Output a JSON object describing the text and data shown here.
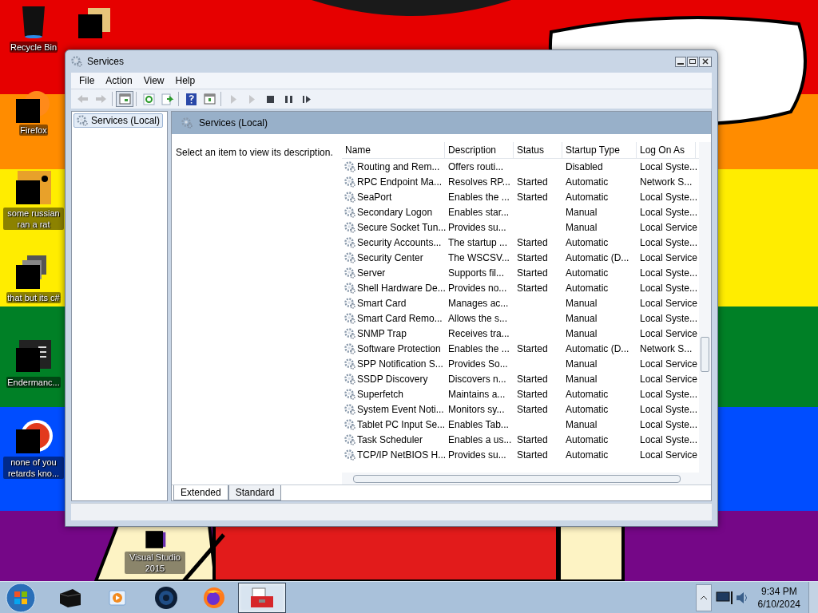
{
  "desktop_icons": [
    {
      "label": "Recycle Bin",
      "kind": "bin"
    },
    {
      "kind": "folder"
    },
    {
      "label": "Firefox",
      "kind": "browser"
    },
    {
      "label": "some russian ran a rat",
      "kind": "editor"
    },
    {
      "label": "that but its c#",
      "kind": "windows"
    },
    {
      "label": "Endermanc...",
      "kind": "console"
    },
    {
      "label": "none of you retards kno...",
      "kind": "bird"
    },
    {
      "label": "Visual Studio 2015",
      "kind": "studio"
    }
  ],
  "window": {
    "title": "Services",
    "menu": [
      "File",
      "Action",
      "View",
      "Help"
    ],
    "toolbar": [
      {
        "kind": "back",
        "disabled": true
      },
      {
        "kind": "forward",
        "disabled": true
      },
      {
        "kind": "pane",
        "disabled": false
      },
      {
        "kind": "refresh",
        "disabled": false
      },
      {
        "kind": "export",
        "disabled": false
      },
      {
        "kind": "help",
        "disabled": false
      },
      {
        "kind": "properties",
        "disabled": false
      },
      {
        "kind": "play",
        "disabled": true
      },
      {
        "kind": "play",
        "disabled": true
      },
      {
        "kind": "stop",
        "disabled": false
      },
      {
        "kind": "pause",
        "disabled": false
      },
      {
        "kind": "resume",
        "disabled": false
      }
    ],
    "tree": [
      {
        "label": "Services (Local)",
        "selected": true
      }
    ],
    "pane_title": "Services (Local)",
    "description_hint": "Select an item to view its description.",
    "table": {
      "columns": [
        "Name",
        "Description",
        "Status",
        "Startup Type",
        "Log On As"
      ],
      "rows": [
        {
          "name": "Routing and Rem...",
          "description": "Offers routi...",
          "startup_type": "Disabled",
          "log_on_as": "Local Syste..."
        },
        {
          "name": "RPC Endpoint Ma...",
          "description": "Resolves RP...",
          "status": "Started",
          "startup_type": "Automatic",
          "log_on_as": "Network S..."
        },
        {
          "name": "SeaPort",
          "description": "Enables the ...",
          "status": "Started",
          "startup_type": "Automatic",
          "log_on_as": "Local Syste..."
        },
        {
          "name": "Secondary Logon",
          "description": "Enables star...",
          "startup_type": "Manual",
          "log_on_as": "Local Syste..."
        },
        {
          "name": "Secure Socket Tun...",
          "description": "Provides su...",
          "startup_type": "Manual",
          "log_on_as": "Local Service"
        },
        {
          "name": "Security Accounts...",
          "description": "The startup ...",
          "status": "Started",
          "startup_type": "Automatic",
          "log_on_as": "Local Syste..."
        },
        {
          "name": "Security Center",
          "description": "The WSCSV...",
          "status": "Started",
          "startup_type": "Automatic (D...",
          "log_on_as": "Local Service"
        },
        {
          "name": "Server",
          "description": "Supports fil...",
          "status": "Started",
          "startup_type": "Automatic",
          "log_on_as": "Local Syste..."
        },
        {
          "name": "Shell Hardware De...",
          "description": "Provides no...",
          "status": "Started",
          "startup_type": "Automatic",
          "log_on_as": "Local Syste..."
        },
        {
          "name": "Smart Card",
          "description": "Manages ac...",
          "startup_type": "Manual",
          "log_on_as": "Local Service"
        },
        {
          "name": "Smart Card Remo...",
          "description": "Allows the s...",
          "startup_type": "Manual",
          "log_on_as": "Local Syste..."
        },
        {
          "name": "SNMP Trap",
          "description": "Receives tra...",
          "startup_type": "Manual",
          "log_on_as": "Local Service"
        },
        {
          "name": "Software Protection",
          "description": "Enables the ...",
          "status": "Started",
          "startup_type": "Automatic (D...",
          "log_on_as": "Network S..."
        },
        {
          "name": "SPP Notification S...",
          "description": "Provides So...",
          "startup_type": "Manual",
          "log_on_as": "Local Service"
        },
        {
          "name": "SSDP Discovery",
          "description": "Discovers n...",
          "status": "Started",
          "startup_type": "Manual",
          "log_on_as": "Local Service"
        },
        {
          "name": "Superfetch",
          "description": "Maintains a...",
          "status": "Started",
          "startup_type": "Automatic",
          "log_on_as": "Local Syste..."
        },
        {
          "name": "System Event Noti...",
          "description": "Monitors sy...",
          "status": "Started",
          "startup_type": "Automatic",
          "log_on_as": "Local Syste..."
        },
        {
          "name": "Tablet PC Input Se...",
          "description": "Enables Tab...",
          "startup_type": "Manual",
          "log_on_as": "Local Syste..."
        },
        {
          "name": "Task Scheduler",
          "description": "Enables a us...",
          "status": "Started",
          "startup_type": "Automatic",
          "log_on_as": "Local Syste..."
        },
        {
          "name": "TCP/IP NetBIOS H...",
          "description": "Provides su...",
          "status": "Started",
          "startup_type": "Automatic",
          "log_on_as": "Local Service"
        }
      ]
    },
    "tabs": [
      {
        "label": "Extended",
        "selected": true
      },
      {
        "label": "Standard",
        "selected": false
      }
    ]
  },
  "taskbar": {
    "items": [
      {
        "kind": "cube",
        "selected": false
      },
      {
        "kind": "media",
        "selected": false
      },
      {
        "kind": "globe",
        "selected": false
      },
      {
        "kind": "firefox",
        "selected": false
      },
      {
        "kind": "toolbox",
        "selected": true
      }
    ],
    "time": "9:34 PM",
    "date": "6/10/2024"
  }
}
